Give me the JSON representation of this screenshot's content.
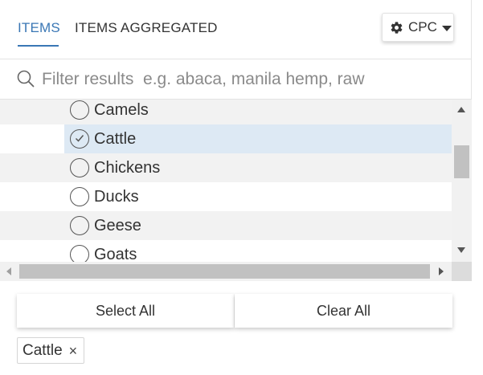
{
  "tabs": {
    "items_label": "ITEMS",
    "aggregated_label": "ITEMS AGGREGATED"
  },
  "classification": {
    "label": "CPC",
    "icon": "gear-icon"
  },
  "filter": {
    "placeholder": "Filter results  e.g. abaca, manila hemp, raw",
    "value": ""
  },
  "list": {
    "items": [
      {
        "label": "Camels",
        "selected": false
      },
      {
        "label": "Cattle",
        "selected": true
      },
      {
        "label": "Chickens",
        "selected": false
      },
      {
        "label": "Ducks",
        "selected": false
      },
      {
        "label": "Geese",
        "selected": false
      },
      {
        "label": "Goats",
        "selected": false
      }
    ]
  },
  "actions": {
    "select_all": "Select All",
    "clear_all": "Clear All"
  },
  "selected_chips": [
    {
      "label": "Cattle",
      "close": "×"
    }
  ],
  "colors": {
    "accent": "#3a77b5",
    "selected_row": "#dde9f4"
  }
}
